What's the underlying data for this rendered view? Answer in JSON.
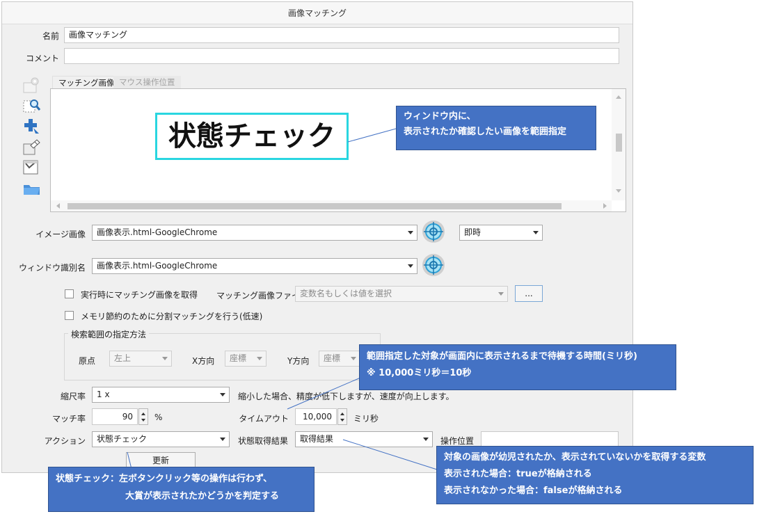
{
  "window": {
    "title": "画像マッチング"
  },
  "form": {
    "name_label": "名前",
    "name_value": "画像マッチング",
    "comment_label": "コメント",
    "comment_value": ""
  },
  "tabs": [
    {
      "label": "マッチング画像",
      "active": true
    },
    {
      "label": "マウス操作位置",
      "active": false
    }
  ],
  "toolbar_icons": [
    "gear-icon",
    "zoom-select-icon",
    "crosshair-plus-icon",
    "edit-image-icon",
    "capture-icon",
    "folder-icon"
  ],
  "preview": {
    "image_text": "状態チェック"
  },
  "image_settings": {
    "image_label": "イメージ画像",
    "image_value": "画像表示.html-GoogleChrome",
    "timing_value": "即時",
    "window_label": "ウィンドウ識別名",
    "window_value": "画像表示.html-GoogleChrome",
    "capture_on_run_label": "実行時にマッチング画像を取得",
    "match_file_label": "マッチング画像ファイル",
    "match_file_placeholder": "変数名もしくは値を選択",
    "browse_label": "...",
    "memory_saving_label": "メモリ節約のために分割マッチングを行う(低速)"
  },
  "search_range": {
    "legend": "検索範囲の指定方法",
    "origin_label": "原点",
    "origin_value": "左上",
    "x_label": "X方向",
    "x_value": "座標",
    "y_label": "Y方向",
    "y_value": "座標"
  },
  "scale": {
    "label": "縮尺率",
    "value": "1 x",
    "note": "縮小した場合、精度が低下しますが、速度が向上します。"
  },
  "match_rate": {
    "label": "マッチ率",
    "value": "90",
    "unit": "%"
  },
  "timeout": {
    "label": "タイムアウト",
    "value": "10,000",
    "unit": "ミリ秒"
  },
  "action": {
    "label": "アクション",
    "value": "状態チェック"
  },
  "result": {
    "label": "状態取得結果",
    "value": "取得結果"
  },
  "op_position": {
    "label": "操作位置",
    "value": ""
  },
  "update_button": "更新",
  "callouts": {
    "window_line1": "ウィンドウ内に、",
    "window_line2": "表示されたか確認したい画像を範囲指定",
    "timeout_line1": "範囲指定した対象が画面内に表示されるまで待機する時間(ミリ秒)",
    "timeout_line2": "※ 10,000ミリ秒＝10秒",
    "result_line1": "対象の画像が幼児されたか、表示されていないかを取得する変数",
    "result_line2": "表示された場合：trueが格納される",
    "result_line3": "表示されなかった場合：falseが格納される",
    "action_line1": "状態チェック：左ボタンクリック等の操作は行わず、",
    "action_line2": "大賞が表示されたかどうかを判定する"
  },
  "colors": {
    "callout_bg": "#4472c4",
    "selection_border": "#29d6e0",
    "dialog_bg": "#f0f0f0"
  }
}
